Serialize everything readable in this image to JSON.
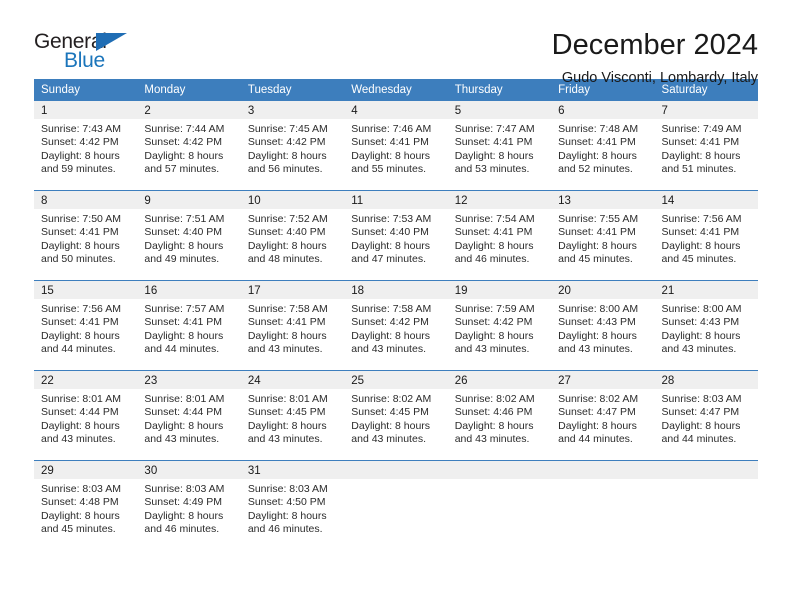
{
  "logo": {
    "primary_text": "General",
    "secondary_text": "Blue",
    "primary_color": "#231f20",
    "secondary_color": "#1b75bb",
    "triangle_color": "#1f6db4"
  },
  "header": {
    "title": "December 2024",
    "subtitle": "Gudo Visconti, Lombardy, Italy"
  },
  "theme": {
    "header_bg": "#3d7ebd",
    "header_text": "#ffffff",
    "daynum_bg": "#efefef",
    "divider": "#3d7ebd"
  },
  "weekday_headers": [
    "Sunday",
    "Monday",
    "Tuesday",
    "Wednesday",
    "Thursday",
    "Friday",
    "Saturday"
  ],
  "weeks": [
    [
      {
        "day": "1",
        "sunrise": "Sunrise: 7:43 AM",
        "sunset": "Sunset: 4:42 PM",
        "daylight_1": "Daylight: 8 hours",
        "daylight_2": "and 59 minutes."
      },
      {
        "day": "2",
        "sunrise": "Sunrise: 7:44 AM",
        "sunset": "Sunset: 4:42 PM",
        "daylight_1": "Daylight: 8 hours",
        "daylight_2": "and 57 minutes."
      },
      {
        "day": "3",
        "sunrise": "Sunrise: 7:45 AM",
        "sunset": "Sunset: 4:42 PM",
        "daylight_1": "Daylight: 8 hours",
        "daylight_2": "and 56 minutes."
      },
      {
        "day": "4",
        "sunrise": "Sunrise: 7:46 AM",
        "sunset": "Sunset: 4:41 PM",
        "daylight_1": "Daylight: 8 hours",
        "daylight_2": "and 55 minutes."
      },
      {
        "day": "5",
        "sunrise": "Sunrise: 7:47 AM",
        "sunset": "Sunset: 4:41 PM",
        "daylight_1": "Daylight: 8 hours",
        "daylight_2": "and 53 minutes."
      },
      {
        "day": "6",
        "sunrise": "Sunrise: 7:48 AM",
        "sunset": "Sunset: 4:41 PM",
        "daylight_1": "Daylight: 8 hours",
        "daylight_2": "and 52 minutes."
      },
      {
        "day": "7",
        "sunrise": "Sunrise: 7:49 AM",
        "sunset": "Sunset: 4:41 PM",
        "daylight_1": "Daylight: 8 hours",
        "daylight_2": "and 51 minutes."
      }
    ],
    [
      {
        "day": "8",
        "sunrise": "Sunrise: 7:50 AM",
        "sunset": "Sunset: 4:41 PM",
        "daylight_1": "Daylight: 8 hours",
        "daylight_2": "and 50 minutes."
      },
      {
        "day": "9",
        "sunrise": "Sunrise: 7:51 AM",
        "sunset": "Sunset: 4:40 PM",
        "daylight_1": "Daylight: 8 hours",
        "daylight_2": "and 49 minutes."
      },
      {
        "day": "10",
        "sunrise": "Sunrise: 7:52 AM",
        "sunset": "Sunset: 4:40 PM",
        "daylight_1": "Daylight: 8 hours",
        "daylight_2": "and 48 minutes."
      },
      {
        "day": "11",
        "sunrise": "Sunrise: 7:53 AM",
        "sunset": "Sunset: 4:40 PM",
        "daylight_1": "Daylight: 8 hours",
        "daylight_2": "and 47 minutes."
      },
      {
        "day": "12",
        "sunrise": "Sunrise: 7:54 AM",
        "sunset": "Sunset: 4:41 PM",
        "daylight_1": "Daylight: 8 hours",
        "daylight_2": "and 46 minutes."
      },
      {
        "day": "13",
        "sunrise": "Sunrise: 7:55 AM",
        "sunset": "Sunset: 4:41 PM",
        "daylight_1": "Daylight: 8 hours",
        "daylight_2": "and 45 minutes."
      },
      {
        "day": "14",
        "sunrise": "Sunrise: 7:56 AM",
        "sunset": "Sunset: 4:41 PM",
        "daylight_1": "Daylight: 8 hours",
        "daylight_2": "and 45 minutes."
      }
    ],
    [
      {
        "day": "15",
        "sunrise": "Sunrise: 7:56 AM",
        "sunset": "Sunset: 4:41 PM",
        "daylight_1": "Daylight: 8 hours",
        "daylight_2": "and 44 minutes."
      },
      {
        "day": "16",
        "sunrise": "Sunrise: 7:57 AM",
        "sunset": "Sunset: 4:41 PM",
        "daylight_1": "Daylight: 8 hours",
        "daylight_2": "and 44 minutes."
      },
      {
        "day": "17",
        "sunrise": "Sunrise: 7:58 AM",
        "sunset": "Sunset: 4:41 PM",
        "daylight_1": "Daylight: 8 hours",
        "daylight_2": "and 43 minutes."
      },
      {
        "day": "18",
        "sunrise": "Sunrise: 7:58 AM",
        "sunset": "Sunset: 4:42 PM",
        "daylight_1": "Daylight: 8 hours",
        "daylight_2": "and 43 minutes."
      },
      {
        "day": "19",
        "sunrise": "Sunrise: 7:59 AM",
        "sunset": "Sunset: 4:42 PM",
        "daylight_1": "Daylight: 8 hours",
        "daylight_2": "and 43 minutes."
      },
      {
        "day": "20",
        "sunrise": "Sunrise: 8:00 AM",
        "sunset": "Sunset: 4:43 PM",
        "daylight_1": "Daylight: 8 hours",
        "daylight_2": "and 43 minutes."
      },
      {
        "day": "21",
        "sunrise": "Sunrise: 8:00 AM",
        "sunset": "Sunset: 4:43 PM",
        "daylight_1": "Daylight: 8 hours",
        "daylight_2": "and 43 minutes."
      }
    ],
    [
      {
        "day": "22",
        "sunrise": "Sunrise: 8:01 AM",
        "sunset": "Sunset: 4:44 PM",
        "daylight_1": "Daylight: 8 hours",
        "daylight_2": "and 43 minutes."
      },
      {
        "day": "23",
        "sunrise": "Sunrise: 8:01 AM",
        "sunset": "Sunset: 4:44 PM",
        "daylight_1": "Daylight: 8 hours",
        "daylight_2": "and 43 minutes."
      },
      {
        "day": "24",
        "sunrise": "Sunrise: 8:01 AM",
        "sunset": "Sunset: 4:45 PM",
        "daylight_1": "Daylight: 8 hours",
        "daylight_2": "and 43 minutes."
      },
      {
        "day": "25",
        "sunrise": "Sunrise: 8:02 AM",
        "sunset": "Sunset: 4:45 PM",
        "daylight_1": "Daylight: 8 hours",
        "daylight_2": "and 43 minutes."
      },
      {
        "day": "26",
        "sunrise": "Sunrise: 8:02 AM",
        "sunset": "Sunset: 4:46 PM",
        "daylight_1": "Daylight: 8 hours",
        "daylight_2": "and 43 minutes."
      },
      {
        "day": "27",
        "sunrise": "Sunrise: 8:02 AM",
        "sunset": "Sunset: 4:47 PM",
        "daylight_1": "Daylight: 8 hours",
        "daylight_2": "and 44 minutes."
      },
      {
        "day": "28",
        "sunrise": "Sunrise: 8:03 AM",
        "sunset": "Sunset: 4:47 PM",
        "daylight_1": "Daylight: 8 hours",
        "daylight_2": "and 44 minutes."
      }
    ],
    [
      {
        "day": "29",
        "sunrise": "Sunrise: 8:03 AM",
        "sunset": "Sunset: 4:48 PM",
        "daylight_1": "Daylight: 8 hours",
        "daylight_2": "and 45 minutes."
      },
      {
        "day": "30",
        "sunrise": "Sunrise: 8:03 AM",
        "sunset": "Sunset: 4:49 PM",
        "daylight_1": "Daylight: 8 hours",
        "daylight_2": "and 46 minutes."
      },
      {
        "day": "31",
        "sunrise": "Sunrise: 8:03 AM",
        "sunset": "Sunset: 4:50 PM",
        "daylight_1": "Daylight: 8 hours",
        "daylight_2": "and 46 minutes."
      },
      {
        "day": "",
        "sunrise": "",
        "sunset": "",
        "daylight_1": "",
        "daylight_2": ""
      },
      {
        "day": "",
        "sunrise": "",
        "sunset": "",
        "daylight_1": "",
        "daylight_2": ""
      },
      {
        "day": "",
        "sunrise": "",
        "sunset": "",
        "daylight_1": "",
        "daylight_2": ""
      },
      {
        "day": "",
        "sunrise": "",
        "sunset": "",
        "daylight_1": "",
        "daylight_2": ""
      }
    ]
  ]
}
